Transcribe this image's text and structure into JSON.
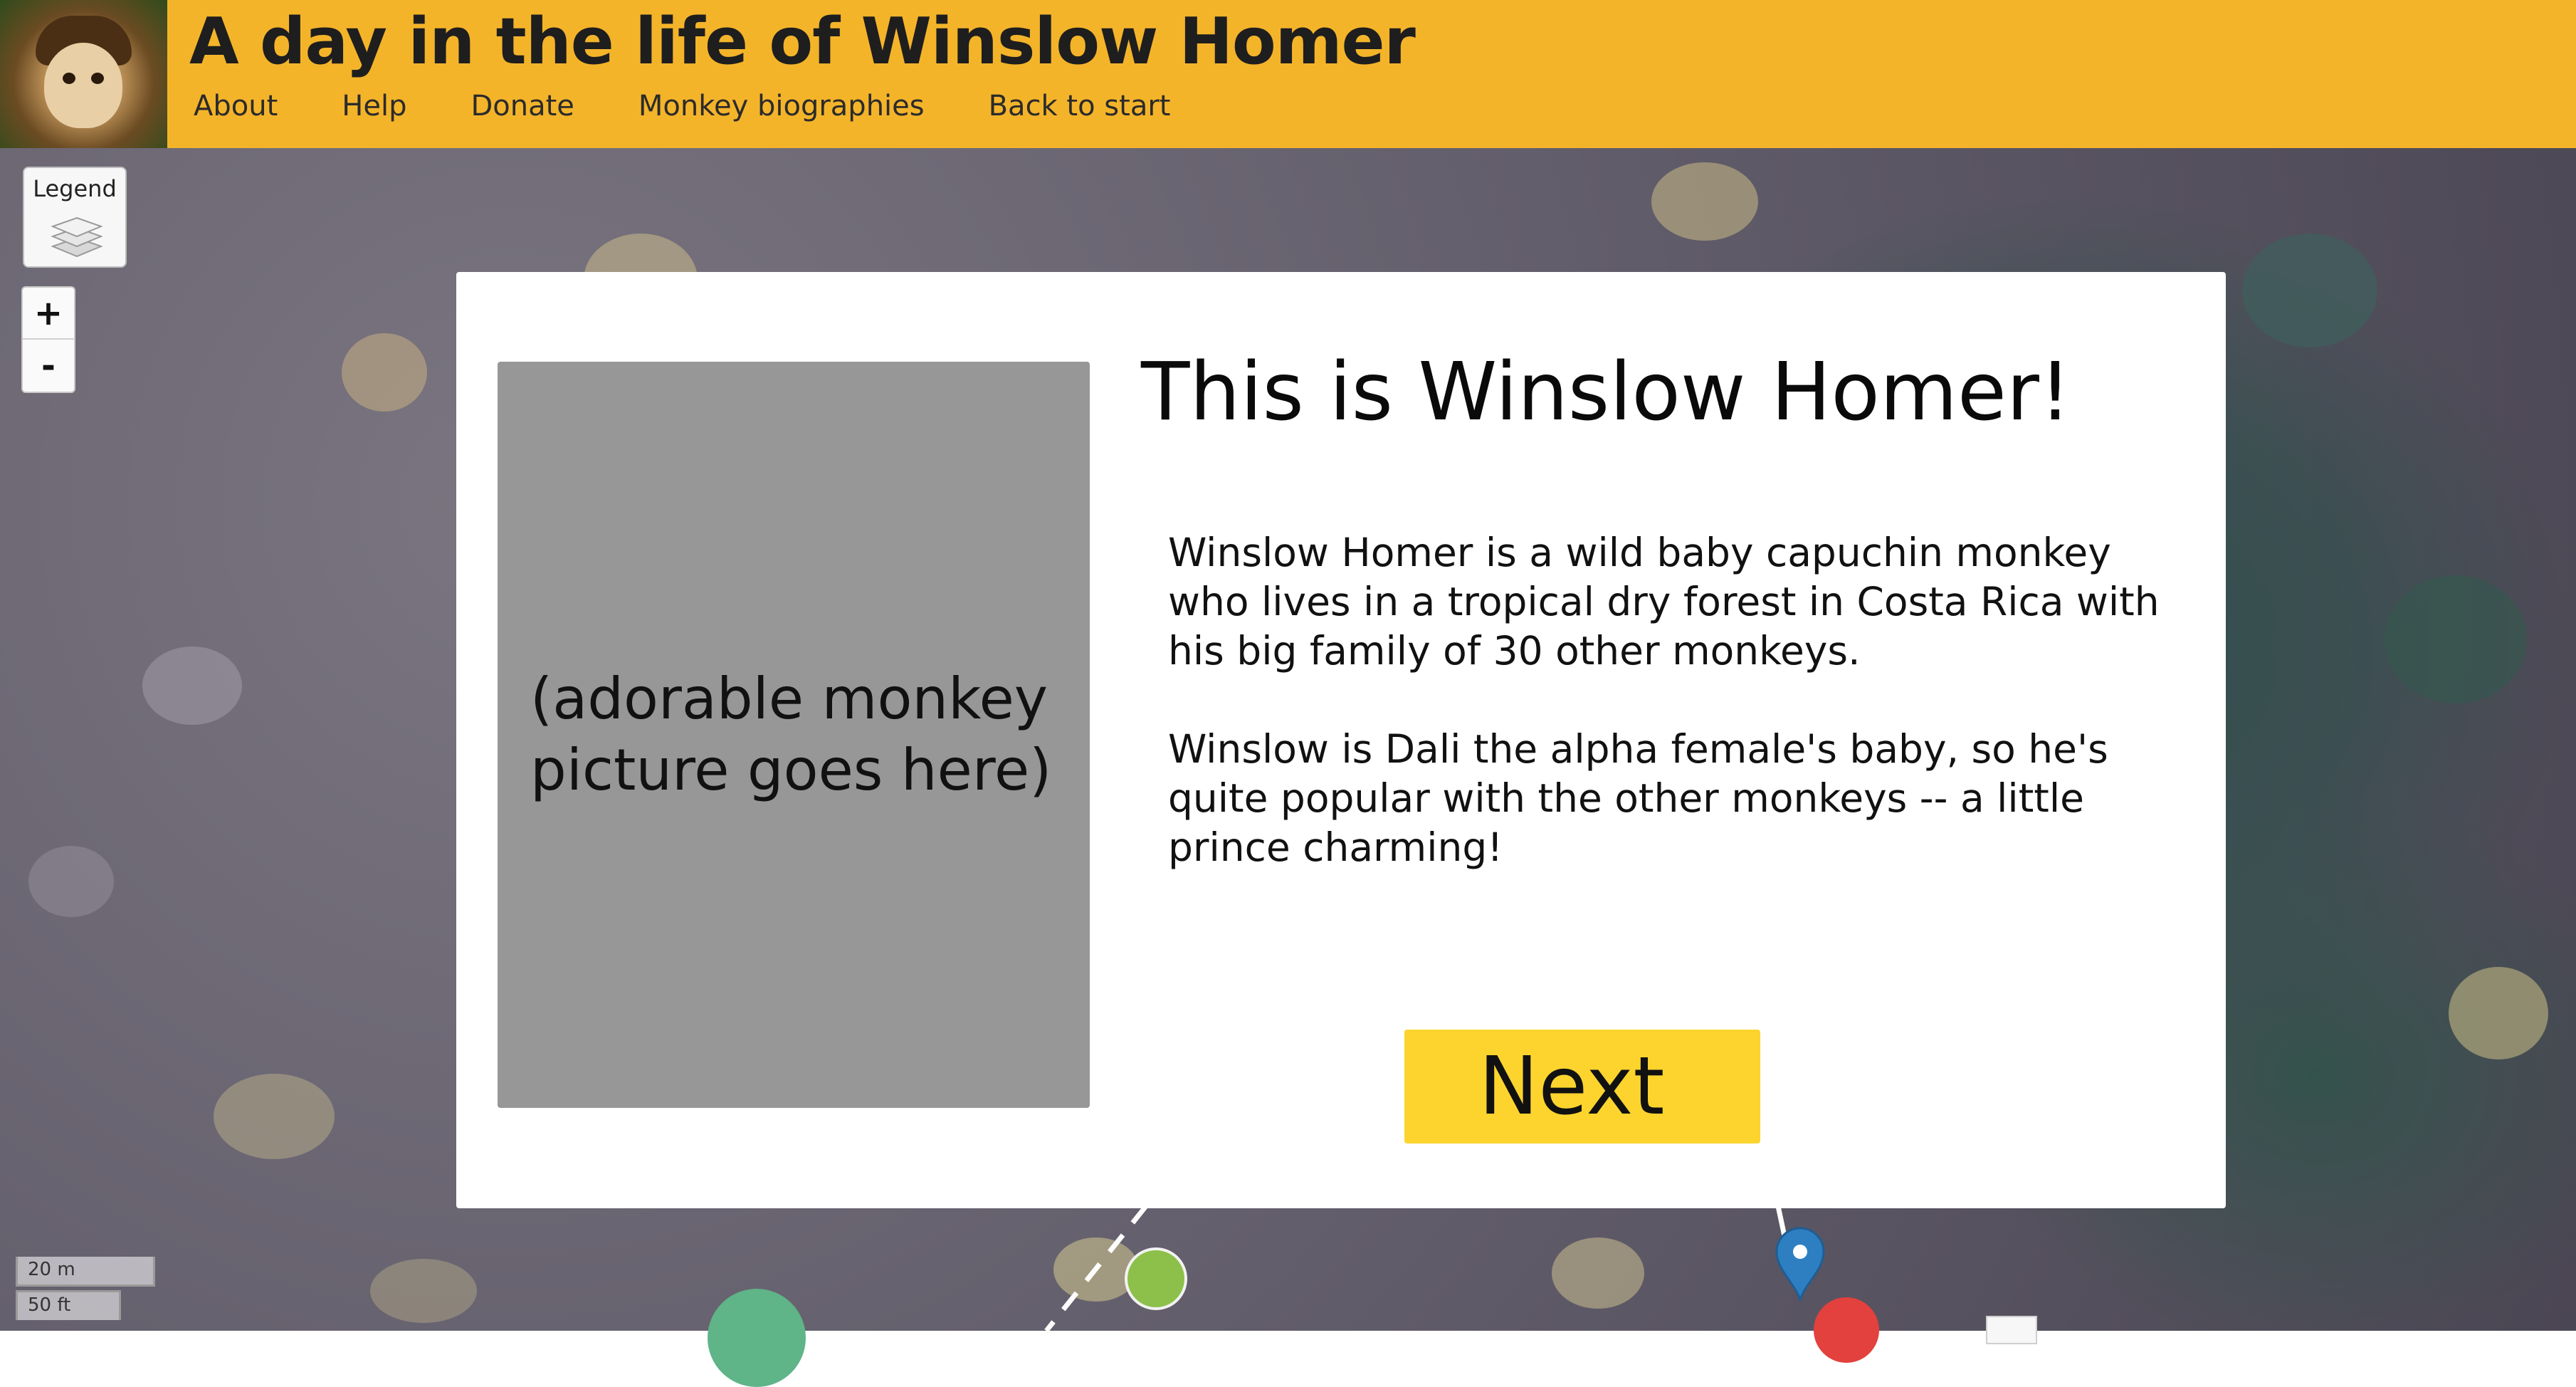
{
  "header": {
    "title": "A day in the life of Winslow Homer",
    "nav": [
      "About",
      "Help",
      "Donate",
      "Monkey biographies",
      "Back to start"
    ],
    "bg_color": "#f4b42a"
  },
  "map": {
    "legend_label": "Legend",
    "legend_icon": "layers-icon",
    "zoom_in": "+",
    "zoom_out": "-",
    "scale_metric": "20 m",
    "scale_imperial": "50 ft"
  },
  "modal": {
    "title": "This is Winslow Homer!",
    "photo_placeholder": "(adorable monkey picture goes here)",
    "paragraphs": [
      "Winslow Homer is a wild baby capuchin monkey who lives in a tropical dry forest in Costa Rica with his big family of 30 other monkeys.",
      "Winslow is Dali the alpha female's baby, so he's quite popular with the other monkeys -- a little prince charming!"
    ],
    "next_label": "Next",
    "next_color": "#fdd42e"
  }
}
